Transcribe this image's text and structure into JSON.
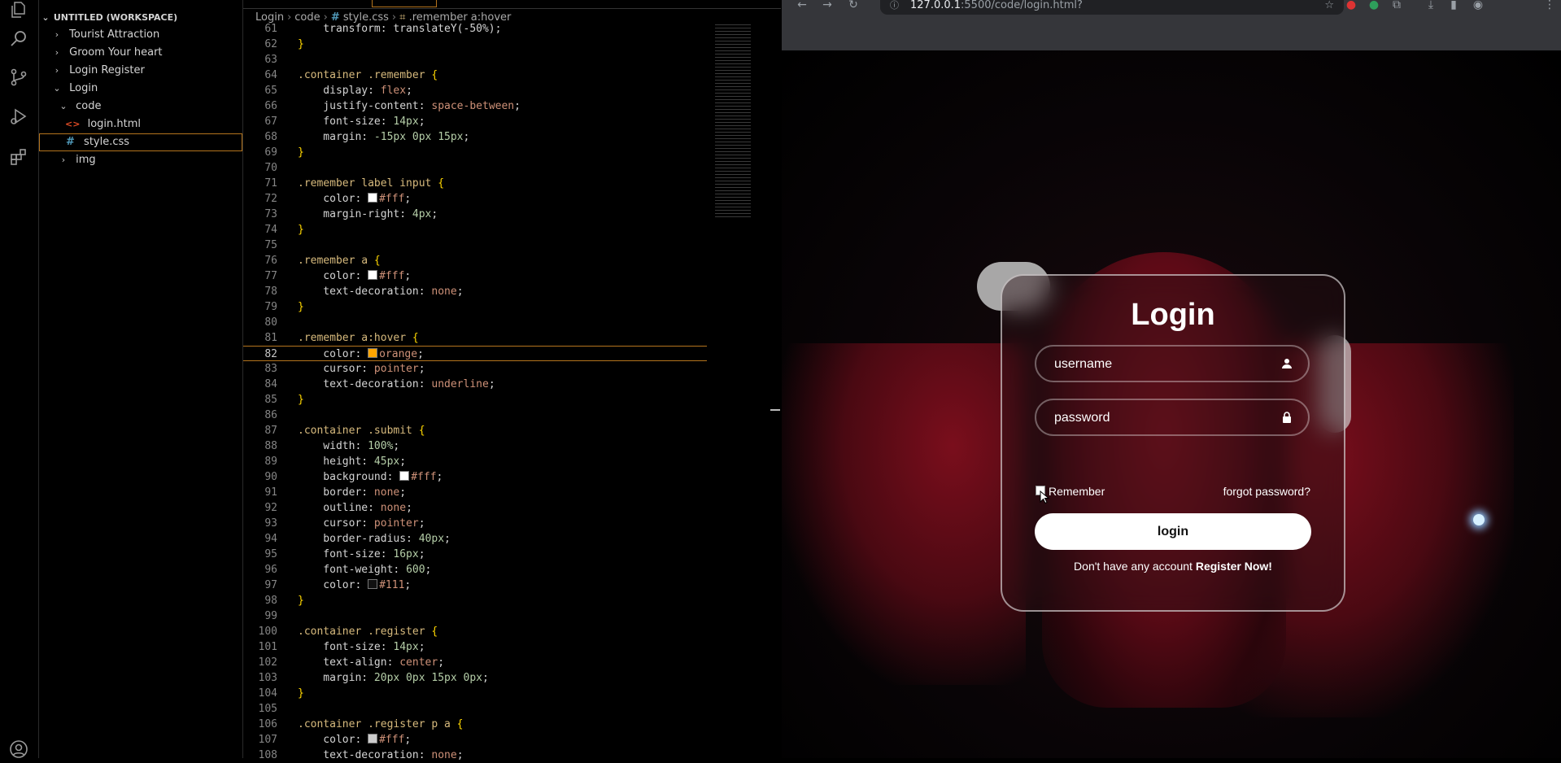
{
  "explorer": {
    "workspace": "UNTITLED (WORKSPACE)",
    "items": [
      {
        "label": "Tourist Attraction",
        "chevron": "›"
      },
      {
        "label": "Groom Your heart",
        "chevron": "›"
      },
      {
        "label": "Login Register",
        "chevron": "›"
      },
      {
        "label": "Login",
        "chevron": "⌄"
      },
      {
        "label": "code",
        "chevron": "⌄"
      },
      {
        "label": "login.html",
        "icon": "<>"
      },
      {
        "label": "style.css",
        "icon": "#"
      },
      {
        "label": "img",
        "chevron": "›"
      }
    ]
  },
  "breadcrumb": {
    "parts": [
      "Login",
      "code",
      "style.css",
      ".remember a:hover"
    ],
    "file_icon": "#",
    "selector_icon": "⌗"
  },
  "code_lines": [
    {
      "n": "61",
      "parts": [
        {
          "t": "    transform: translateY(-50%);",
          "c": "prop"
        }
      ]
    },
    {
      "n": "62",
      "parts": [
        {
          "t": "}",
          "c": "brace"
        }
      ]
    },
    {
      "n": "63",
      "parts": []
    },
    {
      "n": "64",
      "parts": [
        {
          "t": ".container .remember ",
          "c": "sel"
        },
        {
          "t": "{",
          "c": "brace"
        }
      ]
    },
    {
      "n": "65",
      "parts": [
        {
          "t": "    display: ",
          "c": "prop"
        },
        {
          "t": "flex",
          "c": "val"
        },
        {
          "t": ";",
          "c": "punc"
        }
      ]
    },
    {
      "n": "66",
      "parts": [
        {
          "t": "    justify-content: ",
          "c": "prop"
        },
        {
          "t": "space-between",
          "c": "val"
        },
        {
          "t": ";",
          "c": "punc"
        }
      ]
    },
    {
      "n": "67",
      "parts": [
        {
          "t": "    font-size: ",
          "c": "prop"
        },
        {
          "t": "14px",
          "c": "num"
        },
        {
          "t": ";",
          "c": "punc"
        }
      ]
    },
    {
      "n": "68",
      "parts": [
        {
          "t": "    margin: ",
          "c": "prop"
        },
        {
          "t": "-15px 0px 15px",
          "c": "num"
        },
        {
          "t": ";",
          "c": "punc"
        }
      ]
    },
    {
      "n": "69",
      "parts": [
        {
          "t": "}",
          "c": "brace"
        }
      ]
    },
    {
      "n": "70",
      "parts": []
    },
    {
      "n": "71",
      "parts": [
        {
          "t": ".remember label input ",
          "c": "sel"
        },
        {
          "t": "{",
          "c": "brace"
        }
      ]
    },
    {
      "n": "72",
      "parts": [
        {
          "t": "    color: ",
          "c": "prop"
        },
        {
          "sw": "#ffffff"
        },
        {
          "t": "#fff",
          "c": "val"
        },
        {
          "t": ";",
          "c": "punc"
        }
      ]
    },
    {
      "n": "73",
      "parts": [
        {
          "t": "    margin-right: ",
          "c": "prop"
        },
        {
          "t": "4px",
          "c": "num"
        },
        {
          "t": ";",
          "c": "punc"
        }
      ]
    },
    {
      "n": "74",
      "parts": [
        {
          "t": "}",
          "c": "brace"
        }
      ]
    },
    {
      "n": "75",
      "parts": []
    },
    {
      "n": "76",
      "parts": [
        {
          "t": ".remember a ",
          "c": "sel"
        },
        {
          "t": "{",
          "c": "brace"
        }
      ]
    },
    {
      "n": "77",
      "parts": [
        {
          "t": "    color: ",
          "c": "prop"
        },
        {
          "sw": "#ffffff"
        },
        {
          "t": "#fff",
          "c": "val"
        },
        {
          "t": ";",
          "c": "punc"
        }
      ]
    },
    {
      "n": "78",
      "parts": [
        {
          "t": "    text-decoration: ",
          "c": "prop"
        },
        {
          "t": "none",
          "c": "val"
        },
        {
          "t": ";",
          "c": "punc"
        }
      ]
    },
    {
      "n": "79",
      "parts": [
        {
          "t": "}",
          "c": "brace"
        }
      ]
    },
    {
      "n": "80",
      "parts": []
    },
    {
      "n": "81",
      "parts": [
        {
          "t": ".remember a:hover ",
          "c": "sel"
        },
        {
          "t": "{",
          "c": "brace"
        }
      ]
    },
    {
      "n": "82",
      "hl": true,
      "parts": [
        {
          "t": "    color: ",
          "c": "prop"
        },
        {
          "sw": "#ffa500"
        },
        {
          "t": "orange",
          "c": "val"
        },
        {
          "t": ";",
          "c": "punc"
        }
      ]
    },
    {
      "n": "83",
      "parts": [
        {
          "t": "    cursor: ",
          "c": "prop"
        },
        {
          "t": "pointer",
          "c": "val"
        },
        {
          "t": ";",
          "c": "punc"
        }
      ]
    },
    {
      "n": "84",
      "parts": [
        {
          "t": "    text-decoration: ",
          "c": "prop"
        },
        {
          "t": "underline",
          "c": "val"
        },
        {
          "t": ";",
          "c": "punc"
        }
      ]
    },
    {
      "n": "85",
      "parts": [
        {
          "t": "}",
          "c": "brace"
        }
      ]
    },
    {
      "n": "86",
      "parts": []
    },
    {
      "n": "87",
      "parts": [
        {
          "t": ".container .submit ",
          "c": "sel"
        },
        {
          "t": "{",
          "c": "brace"
        }
      ]
    },
    {
      "n": "88",
      "parts": [
        {
          "t": "    width: ",
          "c": "prop"
        },
        {
          "t": "100%",
          "c": "num"
        },
        {
          "t": ";",
          "c": "punc"
        }
      ]
    },
    {
      "n": "89",
      "parts": [
        {
          "t": "    height: ",
          "c": "prop"
        },
        {
          "t": "45px",
          "c": "num"
        },
        {
          "t": ";",
          "c": "punc"
        }
      ]
    },
    {
      "n": "90",
      "parts": [
        {
          "t": "    background: ",
          "c": "prop"
        },
        {
          "sw": "#ffffff"
        },
        {
          "t": "#fff",
          "c": "val"
        },
        {
          "t": ";",
          "c": "punc"
        }
      ]
    },
    {
      "n": "91",
      "parts": [
        {
          "t": "    border: ",
          "c": "prop"
        },
        {
          "t": "none",
          "c": "val"
        },
        {
          "t": ";",
          "c": "punc"
        }
      ]
    },
    {
      "n": "92",
      "parts": [
        {
          "t": "    outline: ",
          "c": "prop"
        },
        {
          "t": "none",
          "c": "val"
        },
        {
          "t": ";",
          "c": "punc"
        }
      ]
    },
    {
      "n": "93",
      "parts": [
        {
          "t": "    cursor: ",
          "c": "prop"
        },
        {
          "t": "pointer",
          "c": "val"
        },
        {
          "t": ";",
          "c": "punc"
        }
      ]
    },
    {
      "n": "94",
      "parts": [
        {
          "t": "    border-radius: ",
          "c": "prop"
        },
        {
          "t": "40px",
          "c": "num"
        },
        {
          "t": ";",
          "c": "punc"
        }
      ]
    },
    {
      "n": "95",
      "parts": [
        {
          "t": "    font-size: ",
          "c": "prop"
        },
        {
          "t": "16px",
          "c": "num"
        },
        {
          "t": ";",
          "c": "punc"
        }
      ]
    },
    {
      "n": "96",
      "parts": [
        {
          "t": "    font-weight: ",
          "c": "prop"
        },
        {
          "t": "600",
          "c": "num"
        },
        {
          "t": ";",
          "c": "punc"
        }
      ]
    },
    {
      "n": "97",
      "parts": [
        {
          "t": "    color: ",
          "c": "prop"
        },
        {
          "sw": "#111111"
        },
        {
          "t": "#111",
          "c": "val"
        },
        {
          "t": ";",
          "c": "punc"
        }
      ]
    },
    {
      "n": "98",
      "parts": [
        {
          "t": "}",
          "c": "brace"
        }
      ]
    },
    {
      "n": "99",
      "parts": []
    },
    {
      "n": "100",
      "parts": [
        {
          "t": ".container .register ",
          "c": "sel"
        },
        {
          "t": "{",
          "c": "brace"
        }
      ]
    },
    {
      "n": "101",
      "parts": [
        {
          "t": "    font-size: ",
          "c": "prop"
        },
        {
          "t": "14px",
          "c": "num"
        },
        {
          "t": ";",
          "c": "punc"
        }
      ]
    },
    {
      "n": "102",
      "parts": [
        {
          "t": "    text-align: ",
          "c": "prop"
        },
        {
          "t": "center",
          "c": "val"
        },
        {
          "t": ";",
          "c": "punc"
        }
      ]
    },
    {
      "n": "103",
      "parts": [
        {
          "t": "    margin: ",
          "c": "prop"
        },
        {
          "t": "20px 0px 15px 0px",
          "c": "num"
        },
        {
          "t": ";",
          "c": "punc"
        }
      ]
    },
    {
      "n": "104",
      "parts": [
        {
          "t": "}",
          "c": "brace"
        }
      ]
    },
    {
      "n": "105",
      "parts": []
    },
    {
      "n": "106",
      "parts": [
        {
          "t": ".container .register p a ",
          "c": "sel"
        },
        {
          "t": "{",
          "c": "brace"
        }
      ]
    },
    {
      "n": "107",
      "parts": [
        {
          "t": "    color: ",
          "c": "prop"
        },
        {
          "sw": "#cccccc"
        },
        {
          "t": "#fff",
          "c": "val"
        },
        {
          "t": ";",
          "c": "punc"
        }
      ]
    },
    {
      "n": "108",
      "parts": [
        {
          "t": "    text-decoration: ",
          "c": "prop"
        },
        {
          "t": "none",
          "c": "val"
        },
        {
          "t": ";",
          "c": "punc"
        }
      ]
    }
  ],
  "browser": {
    "url_host": "127.0.0.1",
    "url_rest": ":5500/code/login.html?"
  },
  "login": {
    "title": "Login",
    "username_placeholder": "username",
    "password_placeholder": "password",
    "remember_label": "Remember",
    "forgot_label": "forgot password?",
    "button_label": "login",
    "register_text": "Don't have any account ",
    "register_link": "Register Now!"
  },
  "colors": {
    "accent_orange": "#b4741d",
    "editor_bg": "#000000",
    "browser_toolbar": "#35363a"
  }
}
